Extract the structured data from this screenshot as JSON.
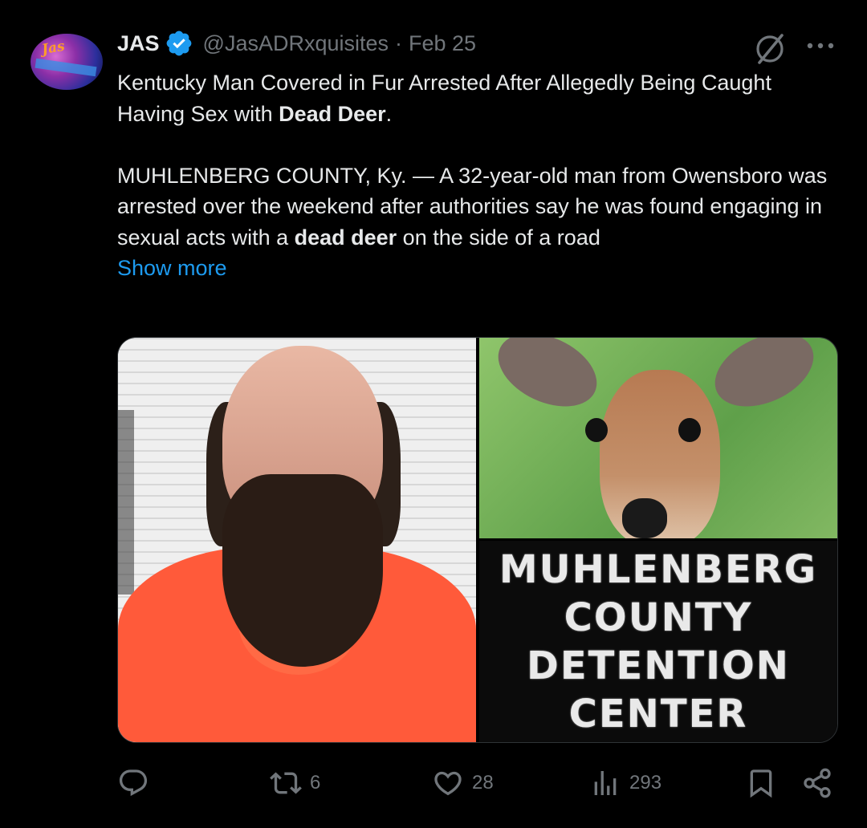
{
  "author": {
    "name": "JAS",
    "handle": "@JasADRxquisites",
    "separator": "·",
    "date": "Feb 25",
    "avatar_text": "Jas"
  },
  "icons": {
    "verified": "verified-badge-icon",
    "grok": "grok-icon",
    "more": "more-icon",
    "reply": "reply-icon",
    "repost": "repost-icon",
    "like": "like-icon",
    "views": "views-icon",
    "bookmark": "bookmark-icon",
    "share": "share-icon"
  },
  "tweet": {
    "headline_part1": "Kentucky Man Covered in Fur Arrested After Allegedly Being Caught Having Sex with ",
    "headline_bold": "Dead Deer",
    "headline_end": ".",
    "body_part1": "MUHLENBERG COUNTY, Ky. — A 32-year-old man from Owensboro was arrested over the weekend after authorities say he was found engaging in sexual acts with a ",
    "body_bold": "dead deer",
    "body_part2": " on the side of a road",
    "show_more": "Show more"
  },
  "media": {
    "sign_lines": [
      "MUHLENBERG",
      "COUNTY",
      "DETENTION",
      "CENTER"
    ]
  },
  "actions": {
    "reply_count": "",
    "repost_count": "6",
    "like_count": "28",
    "views_count": "293"
  },
  "colors": {
    "background": "#000000",
    "text": "#e7e9ea",
    "secondary": "#71767b",
    "link": "#1d9bf0",
    "verified": "#1d9bf0"
  }
}
